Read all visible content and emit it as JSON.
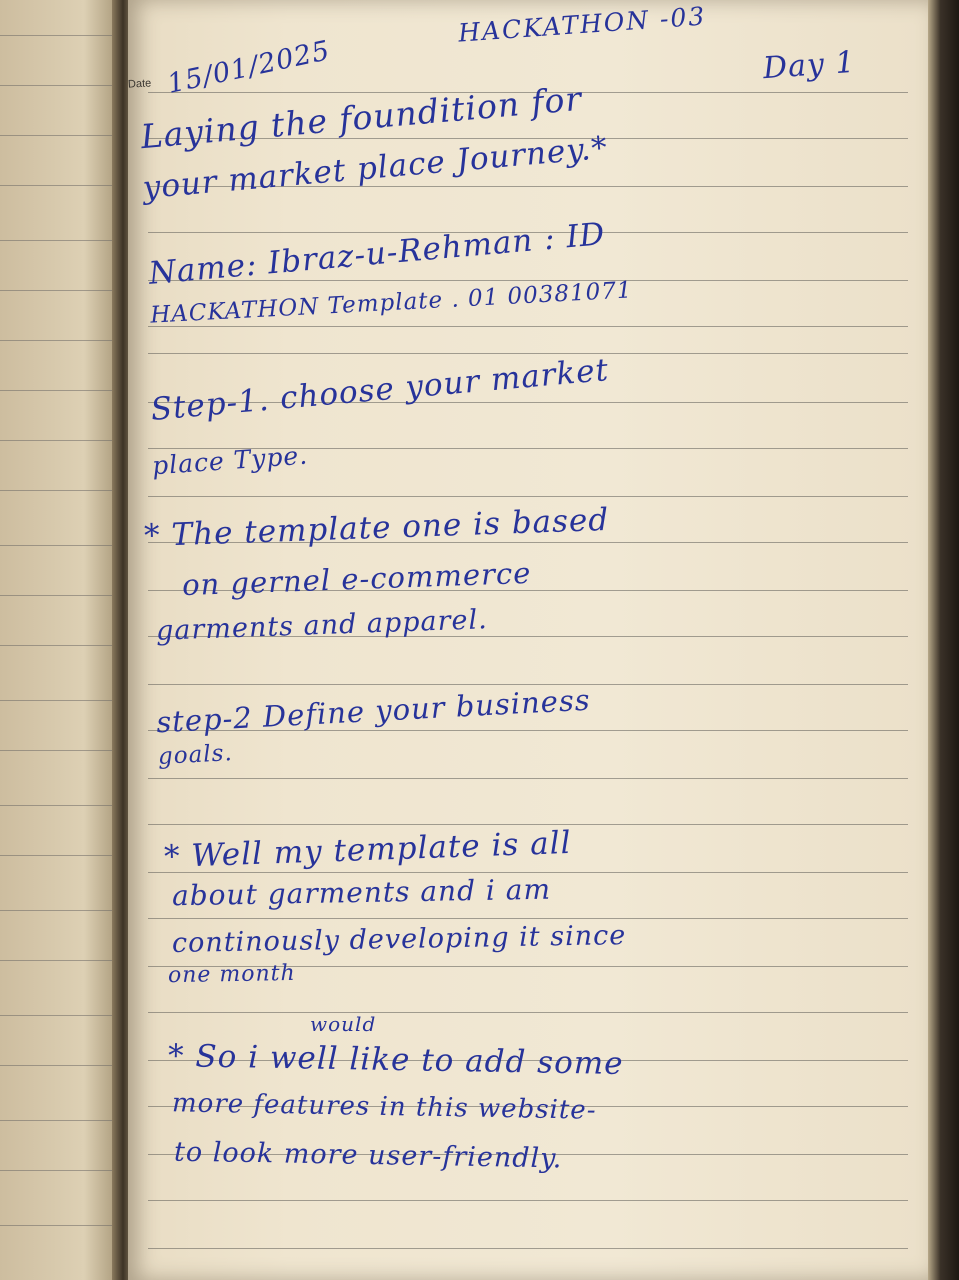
{
  "notebook": {
    "date_label": "Date",
    "date": "15/01/2025",
    "title": "HACKATHON -03",
    "day": "Day 1",
    "heading_line1": "Laying the foundition for",
    "heading_line2": "your market place Journey.*",
    "name_line": "Name: Ibraz-u-Rehman : ID",
    "hackathon_line": "HACKATHON Template . 01 00381071",
    "step1_line1": "Step-1. choose your market",
    "step1_line2": "place Type.",
    "note1_line1": "* The template one is based",
    "note1_line2": "on gernel e-commerce",
    "note1_line3": "garments and apparel.",
    "step2_line1": "step-2 Define your business",
    "step2_line2": "goals.",
    "note2_line1": "* Well my template is all",
    "note2_line2": "about garments and i am",
    "note2_line3": "continously developing it since",
    "note2_line4": "one month",
    "note3_insert": "would",
    "note3_line1": "* So i well like to add some",
    "note3_line2": "more features in this website-",
    "note3_line3": "to look more user-friendly."
  },
  "colors": {
    "ink": "#27339a",
    "paper": "#efe5cf",
    "rule_lines": "#5f5c58"
  }
}
